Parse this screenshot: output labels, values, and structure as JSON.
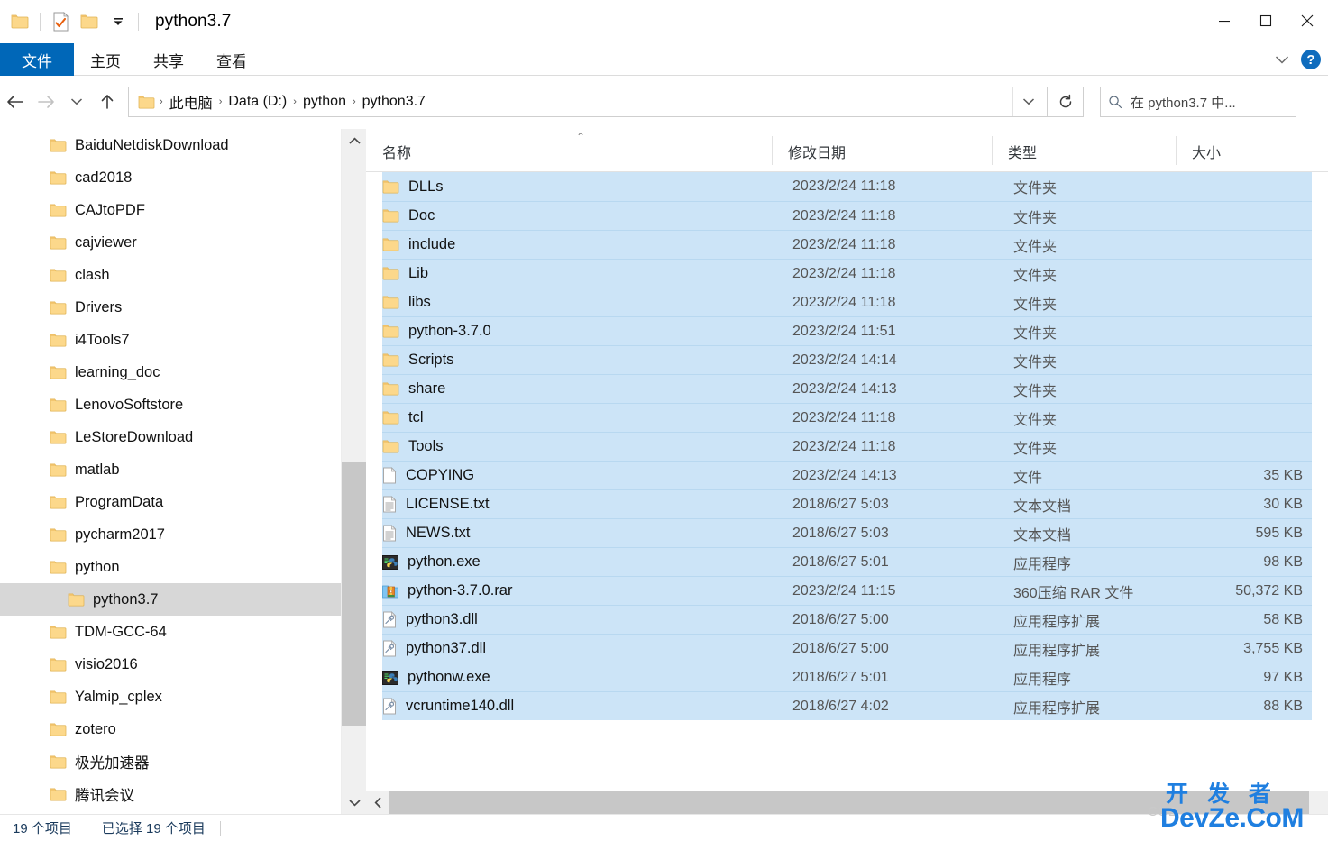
{
  "window": {
    "title": "python3.7",
    "quick_access": [
      {
        "name": "folder-icon",
        "label": "python3.7"
      },
      {
        "name": "properties-icon",
        "label": "属性"
      },
      {
        "name": "new-folder-icon",
        "label": "新建文件夹"
      },
      {
        "name": "customize-dropdown-icon",
        "label": "自定义快速访问工具栏"
      }
    ],
    "controls": {
      "minimize": "最小化",
      "maximize": "最大化",
      "close": "关闭"
    }
  },
  "ribbon": {
    "tabs": [
      {
        "label": "文件",
        "active": true
      },
      {
        "label": "主页",
        "active": false
      },
      {
        "label": "共享",
        "active": false
      },
      {
        "label": "查看",
        "active": false
      }
    ],
    "expand_label": "展开功能区",
    "help_label": "?"
  },
  "address": {
    "back_label": "后退",
    "forward_label": "前进",
    "recent_label": "最近浏览的位置",
    "up_label": "上移到",
    "crumbs": [
      "此电脑",
      "Data (D:)",
      "python",
      "python3.7"
    ],
    "separator": "›",
    "dropdown_label": "历史记录",
    "refresh_label": "刷新"
  },
  "search": {
    "placeholder": "在 python3.7 中...",
    "value": "",
    "icon": "search-icon"
  },
  "sidebar": {
    "items": [
      {
        "label": "BaiduNetdiskDownload",
        "indent": 0,
        "selected": false
      },
      {
        "label": "cad2018",
        "indent": 0,
        "selected": false
      },
      {
        "label": "CAJtoPDF",
        "indent": 0,
        "selected": false
      },
      {
        "label": "cajviewer",
        "indent": 0,
        "selected": false
      },
      {
        "label": "clash",
        "indent": 0,
        "selected": false
      },
      {
        "label": "Drivers",
        "indent": 0,
        "selected": false
      },
      {
        "label": "i4Tools7",
        "indent": 0,
        "selected": false
      },
      {
        "label": "learning_doc",
        "indent": 0,
        "selected": false
      },
      {
        "label": "LenovoSoftstore",
        "indent": 0,
        "selected": false
      },
      {
        "label": "LeStoreDownload",
        "indent": 0,
        "selected": false
      },
      {
        "label": "matlab",
        "indent": 0,
        "selected": false
      },
      {
        "label": "ProgramData",
        "indent": 0,
        "selected": false
      },
      {
        "label": "pycharm2017",
        "indent": 0,
        "selected": false
      },
      {
        "label": "python",
        "indent": 0,
        "selected": false
      },
      {
        "label": "python3.7",
        "indent": 1,
        "selected": true
      },
      {
        "label": "TDM-GCC-64",
        "indent": 0,
        "selected": false
      },
      {
        "label": "visio2016",
        "indent": 0,
        "selected": false
      },
      {
        "label": "Yalmip_cplex",
        "indent": 0,
        "selected": false
      },
      {
        "label": "zotero",
        "indent": 0,
        "selected": false
      },
      {
        "label": "极光加速器",
        "indent": 0,
        "selected": false
      },
      {
        "label": "腾讯会议",
        "indent": 0,
        "selected": false
      }
    ]
  },
  "filelist": {
    "columns": [
      {
        "label": "名称",
        "key": "name"
      },
      {
        "label": "修改日期",
        "key": "date"
      },
      {
        "label": "类型",
        "key": "type"
      },
      {
        "label": "大小",
        "key": "size"
      }
    ],
    "sort": {
      "column": "名称",
      "direction": "asc",
      "caret": "⌃"
    },
    "rows": [
      {
        "name": "DLLs",
        "date": "2023/2/24 11:18",
        "type": "文件夹",
        "size": "",
        "icon": "folder-icon",
        "selected": true
      },
      {
        "name": "Doc",
        "date": "2023/2/24 11:18",
        "type": "文件夹",
        "size": "",
        "icon": "folder-icon",
        "selected": true
      },
      {
        "name": "include",
        "date": "2023/2/24 11:18",
        "type": "文件夹",
        "size": "",
        "icon": "folder-icon",
        "selected": true
      },
      {
        "name": "Lib",
        "date": "2023/2/24 11:18",
        "type": "文件夹",
        "size": "",
        "icon": "folder-icon",
        "selected": true
      },
      {
        "name": "libs",
        "date": "2023/2/24 11:18",
        "type": "文件夹",
        "size": "",
        "icon": "folder-icon",
        "selected": true
      },
      {
        "name": "python-3.7.0",
        "date": "2023/2/24 11:51",
        "type": "文件夹",
        "size": "",
        "icon": "folder-icon",
        "selected": true
      },
      {
        "name": "Scripts",
        "date": "2023/2/24 14:14",
        "type": "文件夹",
        "size": "",
        "icon": "folder-icon",
        "selected": true
      },
      {
        "name": "share",
        "date": "2023/2/24 14:13",
        "type": "文件夹",
        "size": "",
        "icon": "folder-icon",
        "selected": true
      },
      {
        "name": "tcl",
        "date": "2023/2/24 11:18",
        "type": "文件夹",
        "size": "",
        "icon": "folder-icon",
        "selected": true
      },
      {
        "name": "Tools",
        "date": "2023/2/24 11:18",
        "type": "文件夹",
        "size": "",
        "icon": "folder-icon",
        "selected": true
      },
      {
        "name": "COPYING",
        "date": "2023/2/24 14:13",
        "type": "文件",
        "size": "35 KB",
        "icon": "blank-file-icon",
        "selected": true
      },
      {
        "name": "LICENSE.txt",
        "date": "2018/6/27 5:03",
        "type": "文本文档",
        "size": "30 KB",
        "icon": "text-file-icon",
        "selected": true
      },
      {
        "name": "NEWS.txt",
        "date": "2018/6/27 5:03",
        "type": "文本文档",
        "size": "595 KB",
        "icon": "text-file-icon",
        "selected": true
      },
      {
        "name": "python.exe",
        "date": "2018/6/27 5:01",
        "type": "应用程序",
        "size": "98 KB",
        "icon": "python-exe-icon",
        "selected": true
      },
      {
        "name": "python-3.7.0.rar",
        "date": "2023/2/24 11:15",
        "type": "360压缩 RAR 文件",
        "size": "50,372 KB",
        "icon": "rar-archive-icon",
        "selected": true
      },
      {
        "name": "python3.dll",
        "date": "2018/6/27 5:00",
        "type": "应用程序扩展",
        "size": "58 KB",
        "icon": "dll-icon",
        "selected": true
      },
      {
        "name": "python37.dll",
        "date": "2018/6/27 5:00",
        "type": "应用程序扩展",
        "size": "3,755 KB",
        "icon": "dll-icon",
        "selected": true
      },
      {
        "name": "pythonw.exe",
        "date": "2018/6/27 5:01",
        "type": "应用程序",
        "size": "97 KB",
        "icon": "python-exe-icon",
        "selected": true
      },
      {
        "name": "vcruntime140.dll",
        "date": "2018/6/27 4:02",
        "type": "应用程序扩展",
        "size": "88 KB",
        "icon": "dll-icon",
        "selected": true
      }
    ]
  },
  "statusbar": {
    "item_count": "19 个项目",
    "selected_count": "已选择 19 个项目"
  },
  "watermark": {
    "csdn": "CSD",
    "top": "开 发 者",
    "bottom": "DevZe.CoM"
  },
  "colors": {
    "accent_blue": "#0067b8",
    "selection_blue": "#cce4f7",
    "selection_border": "#b8d8f0",
    "tree_selected_gray": "#d7d7d7",
    "folder_yellow": "#fdd98a",
    "status_text": "#1a3a5c",
    "watermark_blue": "#1f7fe0"
  }
}
